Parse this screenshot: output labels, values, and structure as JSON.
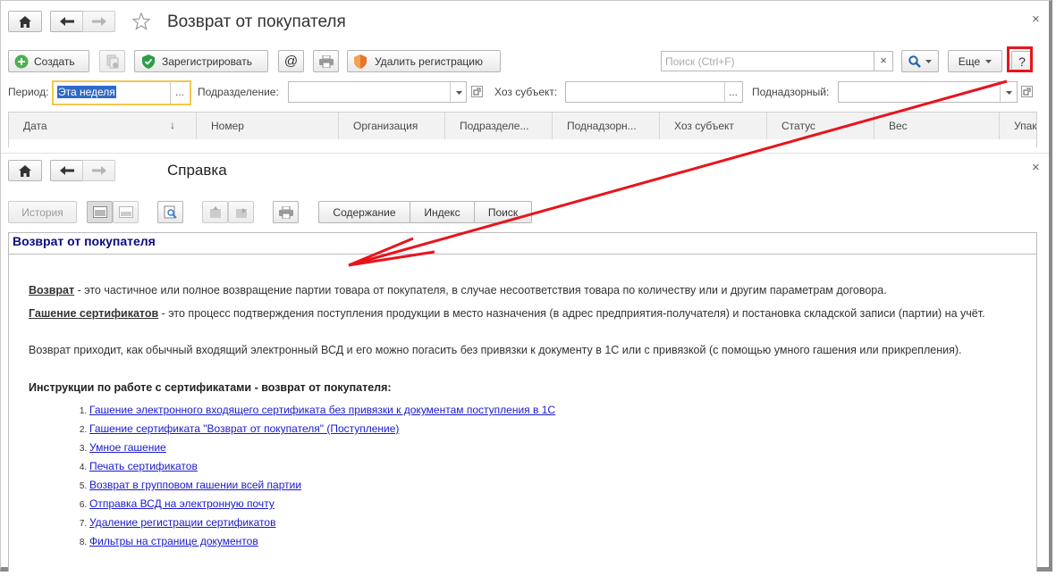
{
  "top_window": {
    "title": "Возврат от покупателя",
    "toolbar": {
      "create_label": "Создать",
      "register_label": "Зарегистрировать",
      "at_label": "@",
      "delete_reg_label": "Удалить регистрацию",
      "search_placeholder": "Поиск (Ctrl+F)",
      "clear_symbol": "×",
      "more_label": "Еще",
      "help_label": "?"
    },
    "filters": {
      "period_label": "Период:",
      "period_value": "Эта неделя",
      "dots": "...",
      "subdivision_label": "Подразделение:",
      "subject_label": "Хоз субъект:",
      "supervised_label": "Поднадзорный:"
    },
    "table": {
      "columns": [
        "Дата",
        "Номер",
        "Организация",
        "Подразделе...",
        "Поднадзорн...",
        "Хоз субъект",
        "Статус",
        "Вес",
        "Упак"
      ],
      "sort_arrow": "↓"
    }
  },
  "help_window": {
    "title": "Справка",
    "toolbar": {
      "history_label": "История",
      "tab_contents": "Содержание",
      "tab_index": "Индекс",
      "tab_search": "Поиск"
    },
    "heading": "Возврат от покупателя",
    "p1_term": "Возврат",
    "p1_text": " - это частичное или полное возвращение партии товара от покупателя, в случае несоответствия товара по количеству или и другим параметрам договора.",
    "p2_term": "Гашение сертификатов",
    "p2_text": " - это процесс подтверждения поступления продукции в место назначения (в адрес предприятия-получателя) и постановка складской записи (партии) на учёт.",
    "p3_text": "Возврат приходит, как обычный входящий электронный ВСД и его можно погасить без привязки к документу в 1С или с привязкой (с помощью умного гашения или прикрепления).",
    "instructions_heading": "Инструкции по работе с сертификатами - возврат от покупателя:",
    "links": [
      "Гашение электронного входящего сертификата без привязки к документам поступления в 1С",
      "Гашение сертификата \"Возврат от покупателя\" (Поступление)",
      "Умное гашение",
      "Печать сертификатов",
      "Возврат в групповом гашении всей партии",
      "Отправка ВСД на электронную почту",
      "Удаление регистрации сертификатов",
      "Фильтры на странице документов"
    ]
  },
  "icons": [
    "home-icon",
    "back-arrow-icon",
    "forward-arrow-icon",
    "star-icon",
    "close-icon",
    "plus-icon",
    "copy-icon",
    "shield-icon",
    "printer-icon",
    "search-icon",
    "chevron-down-icon",
    "open-form-icon"
  ],
  "colors": {
    "highlight_red": "#e8141c",
    "heading_blue": "#0b0b80",
    "link_blue": "#1a1acc",
    "period_focus": "#f2c94c",
    "selection_blue": "#316ac5"
  }
}
